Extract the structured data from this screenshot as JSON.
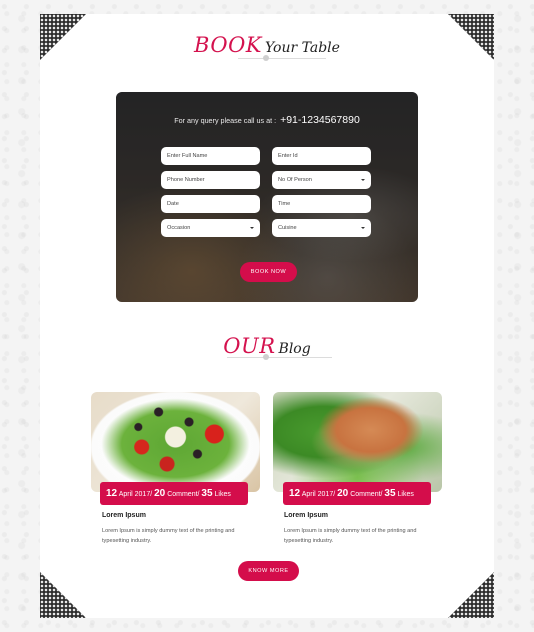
{
  "book_section": {
    "title_main": "BOOK",
    "title_sub": "Your Table",
    "query_text": "For any query please call us at :",
    "phone": "+91-1234567890",
    "fields": {
      "full_name": "Enter Full Name",
      "email": "Enter Id",
      "phone": "Phone Number",
      "persons": "No Of Person",
      "date": "Date",
      "time": "Time",
      "occasion": "Occasion",
      "cuisine": "Cuisine"
    },
    "book_button": "BOOK NOW"
  },
  "blog_section": {
    "title_main": "OUR",
    "title_sub": "Blog",
    "posts": [
      {
        "day": "12",
        "month_year": "April 2017",
        "comments_count": "20",
        "comments_label": "Comment",
        "likes_count": "35",
        "likes_label": "Likes",
        "title": "Lorem Ipsum",
        "text": "Lorem Ipsum is simply dummy text of the printing and typesetting industry.",
        "image": "salad-photo"
      },
      {
        "day": "12",
        "month_year": "April 2017",
        "comments_count": "20",
        "comments_label": "Comment",
        "likes_count": "35",
        "likes_label": "Likes",
        "title": "Lorem Ipsum",
        "text": "Lorem Ipsum is simply dummy text of the printing and typesetting industry.",
        "image": "grilled-chicken-photo"
      }
    ],
    "know_more_button": "KNOW MORE"
  },
  "colors": {
    "accent": "#d40d4b",
    "panel_overlay": "#2c2c2e",
    "page_background": "#f4f4f4"
  },
  "icons": [
    "dropdown-caret-icon"
  ]
}
